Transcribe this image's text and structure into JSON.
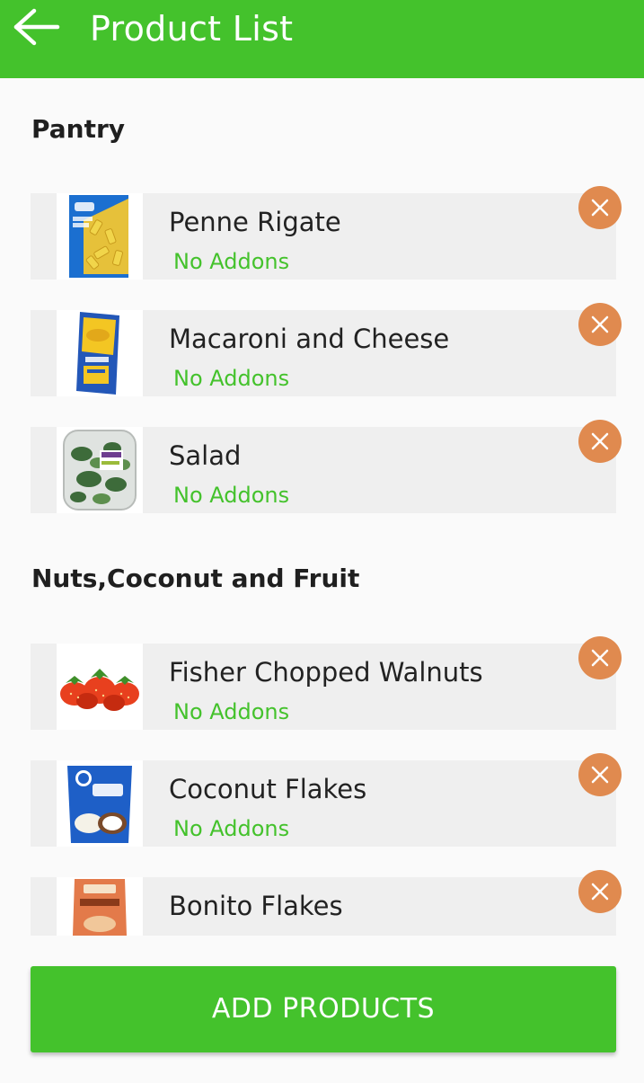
{
  "app_bar": {
    "title": "Product List",
    "back_icon": "arrow-left-icon",
    "color": "#44c22c"
  },
  "sections": [
    {
      "heading": "Pantry",
      "items": [
        {
          "name": "Penne Rigate",
          "addons": "No Addons",
          "image": "penne-box-image",
          "remove_icon": "close-icon"
        },
        {
          "name": "Macaroni and Cheese",
          "addons": "No Addons",
          "image": "mac-and-cheese-box-image",
          "remove_icon": "close-icon"
        },
        {
          "name": "Salad",
          "addons": "No Addons",
          "image": "salad-container-image",
          "remove_icon": "close-icon"
        }
      ]
    },
    {
      "heading": "Nuts,Coconut and Fruit",
      "items": [
        {
          "name": "Fisher Chopped Walnuts",
          "addons": "No Addons",
          "image": "strawberries-image",
          "remove_icon": "close-icon"
        },
        {
          "name": "Coconut Flakes",
          "addons": "No Addons",
          "image": "coconut-flakes-bag-image",
          "remove_icon": "close-icon"
        },
        {
          "name": "Bonito Flakes",
          "image": "bonito-flakes-bag-image",
          "remove_icon": "close-icon"
        }
      ]
    }
  ],
  "add_products_button": {
    "label": "ADD PRODUCTS"
  },
  "colors": {
    "accent": "#44c22c",
    "remove": "#e08a4f",
    "card_bg": "#efefef",
    "page_bg": "#fafafa"
  }
}
